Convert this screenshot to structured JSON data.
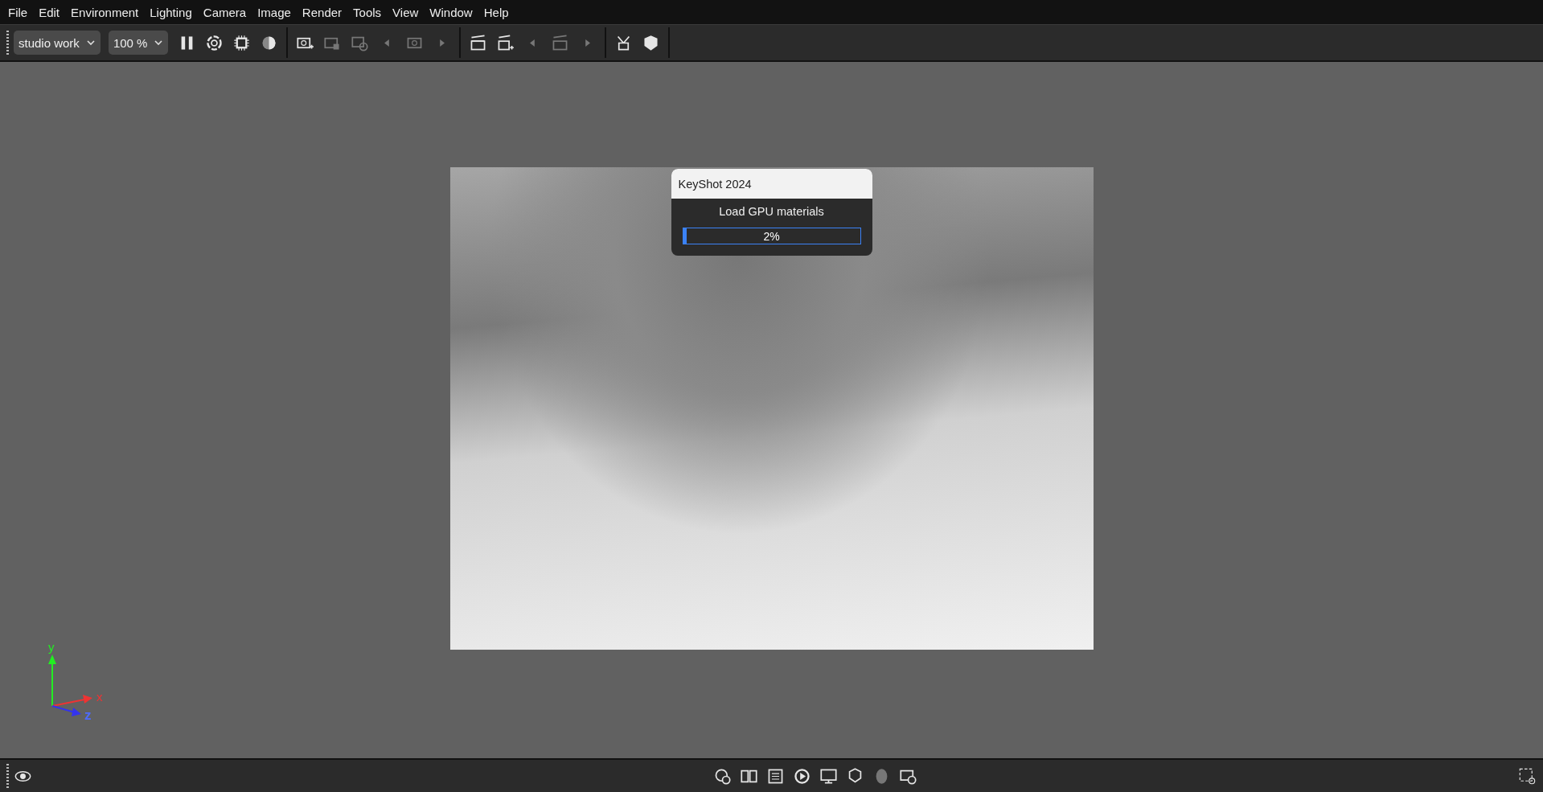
{
  "menu_bar": [
    "File",
    "Edit",
    "Environment",
    "Lighting",
    "Camera",
    "Image",
    "Render",
    "Tools",
    "View",
    "Window",
    "Help"
  ],
  "toolbar": {
    "dropdowns": [
      {
        "value": "studio work"
      },
      {
        "value": "100 %"
      }
    ],
    "groups": [
      [
        {
          "disabled": false
        },
        {
          "disabled": false
        },
        {
          "disabled": false
        },
        {
          "disabled": false
        }
      ],
      [
        {
          "disabled": false
        },
        {
          "disabled": true
        },
        {
          "disabled": true
        },
        {
          "disabled": true
        },
        {
          "disabled": true
        },
        {
          "disabled": true
        }
      ],
      [
        {
          "disabled": false
        },
        {
          "disabled": false
        },
        {
          "disabled": true
        },
        {
          "disabled": true
        },
        {
          "disabled": true
        }
      ],
      [
        {
          "disabled": false
        },
        {
          "disabled": false
        }
      ]
    ]
  },
  "dialog": {
    "title": "KeyShot 2024",
    "message": "Load GPU materials",
    "progress": {
      "level": 0.02,
      "reading": "2%"
    }
  },
  "axis_gizmo": {
    "y": "y",
    "x": "x",
    "z": "z"
  },
  "bottom_bar": [
    {
      "disabled": false
    },
    {
      "disabled": false
    },
    {
      "disabled": false
    },
    {
      "disabled": false
    },
    {
      "disabled": false
    },
    {
      "disabled": false
    },
    {
      "disabled": true
    },
    {
      "disabled": false
    }
  ]
}
